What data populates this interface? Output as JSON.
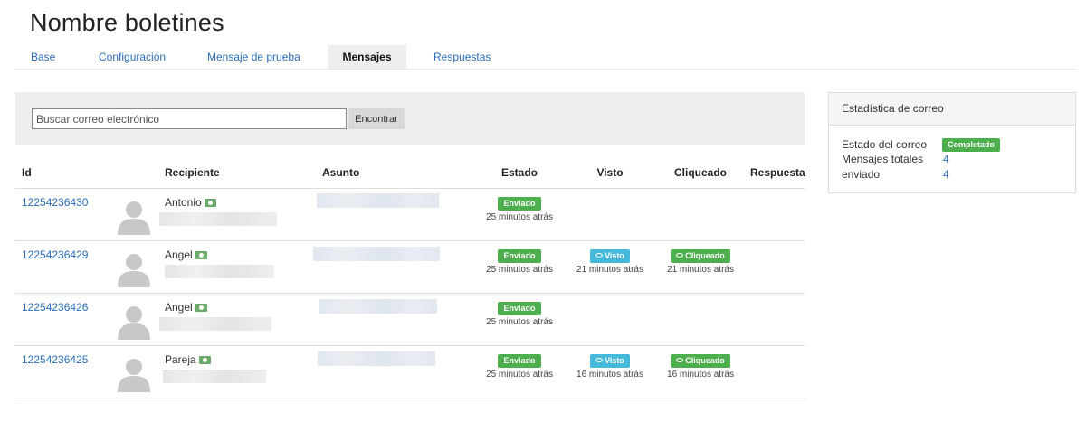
{
  "page": {
    "title": "Nombre boletines"
  },
  "tabs": [
    {
      "label": "Base"
    },
    {
      "label": "Configuración"
    },
    {
      "label": "Mensaje de prueba"
    },
    {
      "label": "Mensajes",
      "active": true
    },
    {
      "label": "Respuestas"
    }
  ],
  "search": {
    "placeholder": "Buscar correo electrónico",
    "value": "",
    "button_label": "Encontrar"
  },
  "table": {
    "headers": [
      "Id",
      "Recipiente",
      "Asunto",
      "Estado",
      "Visto",
      "Cliqueado",
      "Respuesta"
    ],
    "rows": [
      {
        "id": "12254236430",
        "recipient": "Antonio",
        "estado": "Enviado",
        "estado_time": "25 minutos atrás",
        "visto": "",
        "visto_time": "",
        "cliqueado": "",
        "cliqueado_time": ""
      },
      {
        "id": "12254236429",
        "recipient": "Angel",
        "estado": "Enviado",
        "estado_time": "25 minutos atrás",
        "visto": "Visto",
        "visto_time": "21 minutos atrás",
        "cliqueado": "Cliqueado",
        "cliqueado_time": "21 minutos atrás"
      },
      {
        "id": "12254236426",
        "recipient": "Angel",
        "estado": "Enviado",
        "estado_time": "25 minutos atrás",
        "visto": "",
        "visto_time": "",
        "cliqueado": "",
        "cliqueado_time": ""
      },
      {
        "id": "12254236425",
        "recipient": "Pareja",
        "estado": "Enviado",
        "estado_time": "25 minutos atrás",
        "visto": "Visto",
        "visto_time": "16 minutos atrás",
        "cliqueado": "Cliqueado",
        "cliqueado_time": "16 minutos atrás"
      }
    ]
  },
  "stats": {
    "title": "Estadística de correo",
    "estado_label": "Estado del correo",
    "estado_value": "Completado",
    "total_label": "Mensajes totales",
    "total_value": "4",
    "enviado_label": "enviado",
    "enviado_value": "4"
  },
  "colors": {
    "link": "#2a6ebb",
    "success": "#4cae4c",
    "info": "#46b8da",
    "panel_bg": "#eeeeee"
  },
  "icons": {
    "avatar": "user-silhouette-icon",
    "recipient": "money-bill-icon",
    "visto": "eye-icon",
    "cliqueado": "eye-icon"
  }
}
